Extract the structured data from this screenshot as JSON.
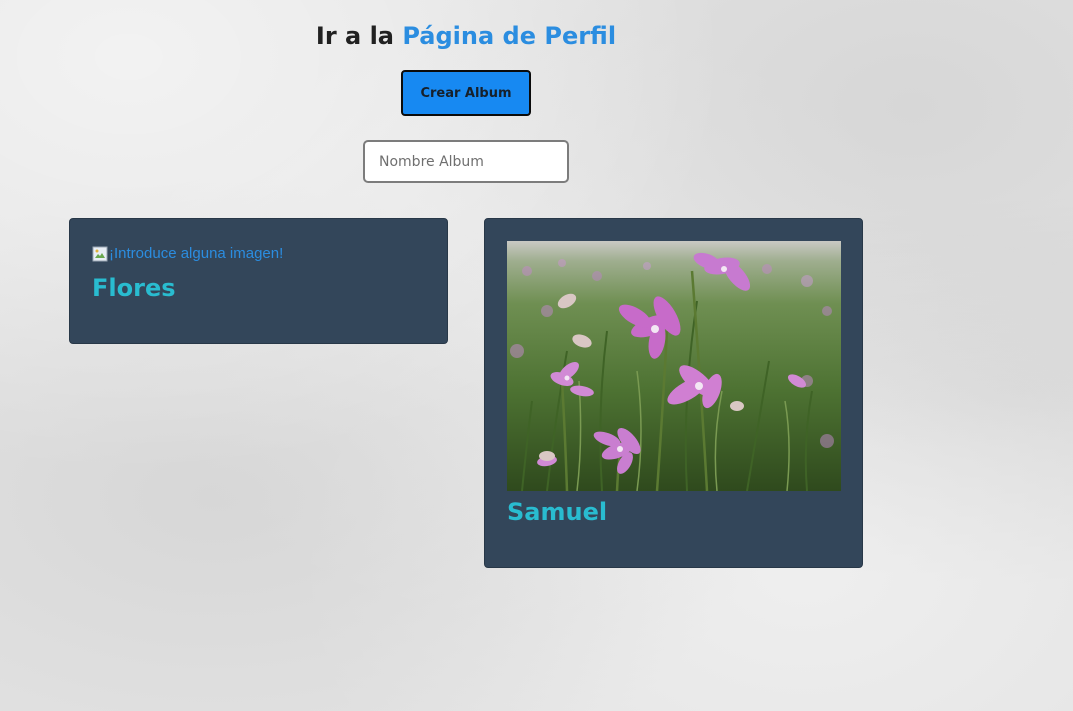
{
  "header": {
    "prefix": "Ir a la",
    "link_label": "Página de Perfil"
  },
  "actions": {
    "create_album_label": "Crear Album",
    "album_name_placeholder": "Nombre Album",
    "album_name_value": ""
  },
  "albums": [
    {
      "title": "Flores",
      "image_alt": "¡Introduce alguna imagen!",
      "image_loaded": false
    },
    {
      "title": "Samuel",
      "image_alt": "",
      "image_loaded": true,
      "image_description": "photo-pink-flowers-field"
    }
  ],
  "colors": {
    "card_background": "#33465a",
    "title_accent": "#29bcd0",
    "link": "#2b8de0",
    "button": "#1789f2"
  }
}
